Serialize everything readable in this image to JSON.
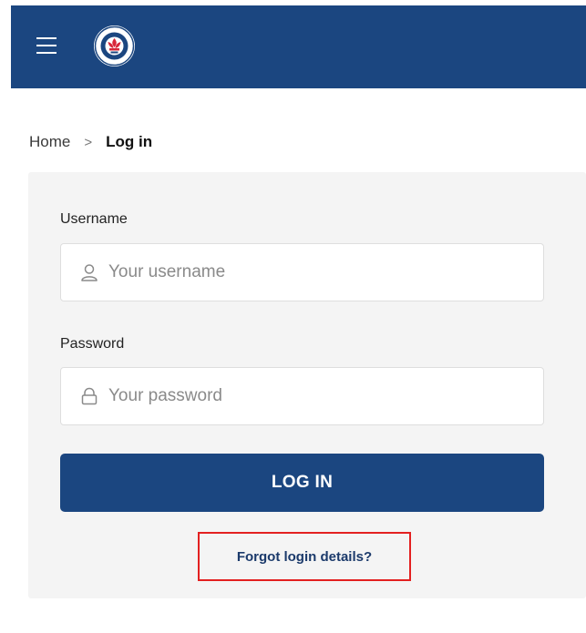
{
  "header": {
    "menu_icon": "hamburger-icon",
    "logo": "site-logo-emblem",
    "bg_color": "#1b4680"
  },
  "breadcrumb": {
    "home": "Home",
    "separator": ">",
    "current": "Log in"
  },
  "form": {
    "username_label": "Username",
    "username_placeholder": "Your username",
    "username_icon": "user-icon",
    "password_label": "Password",
    "password_placeholder": "Your password",
    "password_icon": "lock-icon",
    "login_button": "LOG IN",
    "forgot_link": "Forgot login details?"
  },
  "colors": {
    "primary": "#1b4680",
    "highlight_box": "#e32020"
  }
}
